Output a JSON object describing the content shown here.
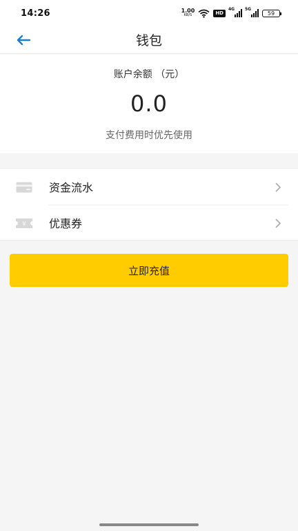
{
  "status_bar": {
    "time": "14:26",
    "net_speed_value": "1.00",
    "net_speed_unit": "KB/S",
    "hd_label": "HD",
    "signal1_tag": "4G",
    "signal2_tag": "5G",
    "battery": "59"
  },
  "header": {
    "title": "钱包",
    "back_icon": "arrow-left-icon",
    "accent_color": "#1a7fd4"
  },
  "balance": {
    "label": "账户余额 （元）",
    "amount": "0.0",
    "note": "支付费用时优先使用"
  },
  "menu": {
    "items": [
      {
        "label": "资金流水",
        "icon": "card-icon"
      },
      {
        "label": "优惠券",
        "icon": "coupon-icon"
      }
    ]
  },
  "actions": {
    "recharge_label": "立即充值",
    "recharge_color": "#ffcc00"
  }
}
